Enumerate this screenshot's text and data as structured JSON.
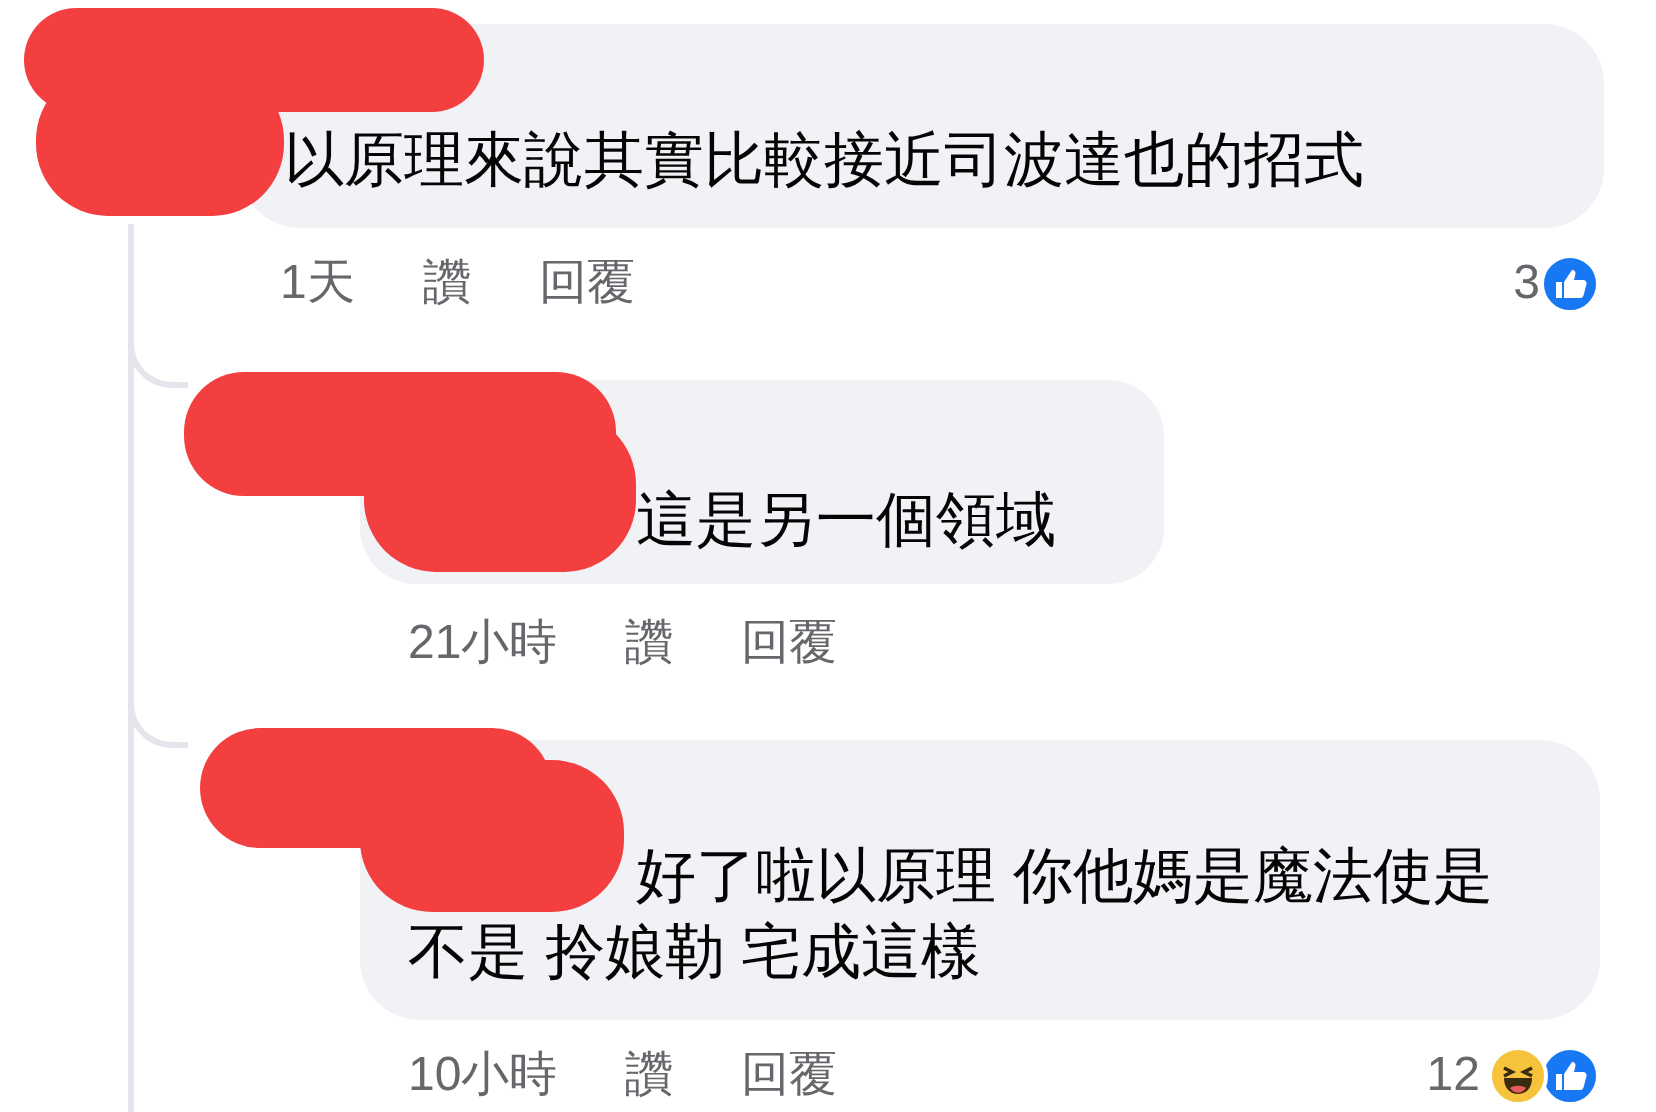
{
  "comments": [
    {
      "author_redacted": true,
      "text": "以原理來說其實比較接近司波達也的招式",
      "time": "1天",
      "like": "讚",
      "reply": "回覆",
      "reaction_count": "3",
      "reactions": [
        {
          "kind": "like"
        }
      ],
      "replies": [
        {
          "author_redacted": true,
          "text": "這是另一個領域",
          "time": "21小時",
          "like": "讚",
          "reply": "回覆"
        },
        {
          "author_redacted": true,
          "text": "好了啦以原理 你他媽是魔法使是不是 拎娘勒 宅成這樣",
          "time": "10小時",
          "like": "讚",
          "reply": "回覆",
          "reaction_count": "12",
          "reactions": [
            {
              "kind": "haha"
            },
            {
              "kind": "like"
            }
          ]
        }
      ]
    }
  ]
}
